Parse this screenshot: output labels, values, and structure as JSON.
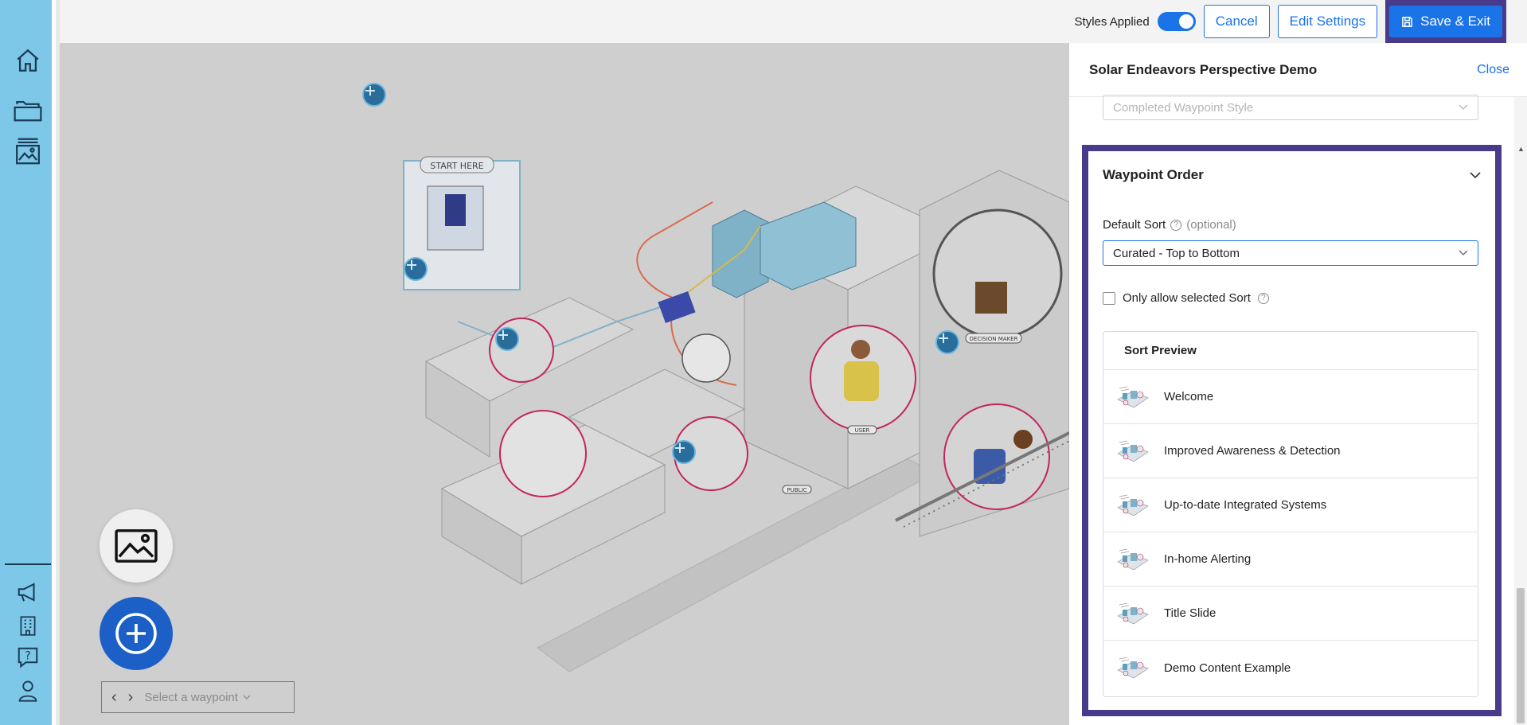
{
  "rail": {
    "items": [
      {
        "name": "home-icon"
      },
      {
        "name": "folder-icon"
      },
      {
        "name": "gallery-icon"
      },
      {
        "name": "megaphone-icon"
      },
      {
        "name": "building-icon"
      },
      {
        "name": "help-icon"
      },
      {
        "name": "user-icon"
      }
    ]
  },
  "topbar": {
    "styles_label": "Styles Applied",
    "styles_on": true,
    "cancel_label": "Cancel",
    "edit_settings_label": "Edit Settings",
    "save_exit_label": "Save & Exit"
  },
  "canvas": {
    "illustration_labels": {
      "start_here": "START HERE",
      "decision_maker": "DECISION MAKER",
      "user": "USER",
      "public": "PUBLIC"
    },
    "waypoint_nav": {
      "placeholder": "Select a waypoint"
    }
  },
  "panel": {
    "title": "Solar Endeavors Perspective Demo",
    "close_label": "Close",
    "completed_style_placeholder": "Completed Waypoint Style",
    "waypoint_order": {
      "title": "Waypoint Order",
      "default_sort_label": "Default Sort",
      "optional_label": "(optional)",
      "default_sort_value": "Curated - Top to Bottom",
      "only_allow_label": "Only allow selected Sort",
      "only_allow_checked": false,
      "preview_title": "Sort Preview",
      "preview_items": [
        {
          "label": "Welcome"
        },
        {
          "label": "Improved Awareness & Detection"
        },
        {
          "label": "Up-to-date Integrated Systems"
        },
        {
          "label": "In-home Alerting"
        },
        {
          "label": "Title Slide"
        },
        {
          "label": "Demo Content Example"
        }
      ]
    }
  },
  "colors": {
    "accent": "#1b73e8",
    "highlight_border": "#4a3a8c",
    "rail_bg": "#7dc7e8",
    "fab_blue": "#1b5fc7"
  }
}
